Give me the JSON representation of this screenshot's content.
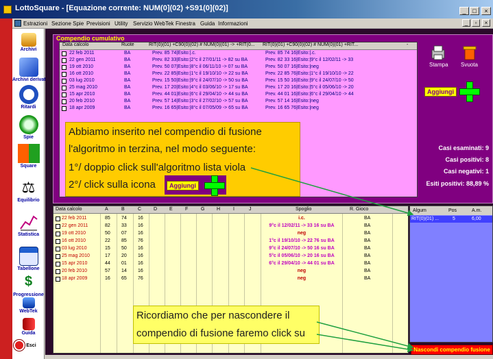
{
  "window": {
    "title": "LottoSquare - [Equazione corrente: NUM(0](02) +S91(0](02)]"
  },
  "menu": [
    "Estrazioni",
    "Sezione Spie",
    "Previsioni",
    "Utility",
    "Servizio WebTek",
    "Finestra",
    "Guida",
    "Informazioni"
  ],
  "toolbar": {
    "items": [
      {
        "label": "Archivi",
        "icon": "archive-icon"
      },
      {
        "label": "Archivi derivati",
        "icon": "derived-archive-icon"
      },
      {
        "label": "Ritardi",
        "icon": "clock-icon"
      },
      {
        "label": "Spie",
        "icon": "spyglass-icon"
      },
      {
        "label": "Square",
        "icon": "squares-icon"
      },
      {
        "label": "Equilibrio",
        "icon": "scales-icon"
      },
      {
        "label": "Statistica",
        "icon": "chart-icon"
      },
      {
        "label": "Tabellone",
        "icon": "calendar-icon"
      },
      {
        "label": "Progressione",
        "icon": "dollar-icon"
      },
      {
        "label": "WebTek",
        "icon": "webtek-icon"
      },
      {
        "label": "Guida",
        "icon": "book-icon"
      },
      {
        "label": "Esci",
        "icon": "exit-icon"
      }
    ]
  },
  "compendio": {
    "title": "Compendio cumulativo",
    "headers": [
      "Data calcolo",
      "Ruote",
      "RIT(0)(01) +C90(0)(02) # NUM(0)(01) -> +RIT(0...",
      "RIT(0)(01) +C90(0)(02) # NUM(0)(01) +RIT...",
      "-"
    ],
    "rows": [
      {
        "date": "22 feb 2011",
        "ruota": "BA",
        "c1": "Prev. 85 74|Esito:|.c.",
        "c2": "Prev. 85 74 16|Esito:|.c."
      },
      {
        "date": "22 gen 2011",
        "ruota": "BA",
        "c1": "Prev. 82 33|Esito:|2°c il 27/01/11 -> 82 su BA",
        "c2": "Prev. 82 33 16|Esito:|9°c il 12/02/11 -> 33"
      },
      {
        "date": "19 ott 2010",
        "ruota": "BA",
        "c1": "Prev. 50 07|Esito:|8°c il 06/11/10 -> 07 su BA",
        "c2": "Prev. 50 07 16|Esito:|neg"
      },
      {
        "date": "16 ott 2010",
        "ruota": "BA",
        "c1": "Prev. 22 85|Esito:|1°c il 19/10/10 -> 22 su BA",
        "c2": "Prev. 22 85 76|Esito:|1°c il 19/10/10 -> 22"
      },
      {
        "date": "03 lug 2010",
        "ruota": "BA",
        "c1": "Prev. 15 50|Esito:|9°c il 24/07/10 -> 50 su BA",
        "c2": "Prev. 15 50 16|Esito:|9°c il 24/07/10 -> 50"
      },
      {
        "date": "25 mag 2010",
        "ruota": "BA",
        "c1": "Prev. 17 20|Esito:|4°c il 03/06/10 -> 17 su BA",
        "c2": "Prev. 17 20 16|Esito:|5°c il 05/06/10 -> 20"
      },
      {
        "date": "15 apr 2010",
        "ruota": "BA",
        "c1": "Prev. 44 01|Esito:|6°c il 29/04/10 -> 44 su BA",
        "c2": "Prev. 44 01 16|Esito:|6°c il 29/04/10 -> 44"
      },
      {
        "date": "20 feb 2010",
        "ruota": "BA",
        "c1": "Prev. 57 14|Esito:|3°c il 27/02/10 -> 57 su BA",
        "c2": "Prev. 57 14 16|Esito:|neg"
      },
      {
        "date": "18 apr 2009",
        "ruota": "BA",
        "c1": "Prev. 16 65|Esito:|8°c il 07/05/09 -> 65 su BA",
        "c2": "Prev. 16 65 76|Esito:|neg"
      }
    ]
  },
  "actions": {
    "stampa": "Stampa",
    "svuota": "Svuota",
    "aggiungi": "Aggiungi"
  },
  "stats": {
    "casi_esaminati": "Casi esaminati: 9",
    "casi_positivi": "Casi positivi: 8",
    "casi_negativi": "Casi negativi: 1",
    "esiti_positivi": "Esiti positivi: 88,89 %"
  },
  "callout1": {
    "lines": [
      "Abbiamo inserito nel compendio di fusione",
      "l'algoritmo in terzina, nel modo seguente:",
      "1°/ doppio click sull'algoritmo lista viola",
      "2°/ click sulla icona"
    ]
  },
  "callout2": {
    "lines": [
      "Ricordiamo che per nascondere il",
      "compendio di fusione faremo click su"
    ]
  },
  "bottom": {
    "headers": [
      "Data calcolo",
      "A",
      "B",
      "C",
      "D",
      "E",
      "F",
      "G",
      "H",
      "I",
      "J",
      "Spoglio",
      "R. Gioco"
    ],
    "rows": [
      {
        "date": "22 feb 2011",
        "a": "85",
        "b": "74",
        "c": "16",
        "spoglio": "i.c.",
        "ruota": "BA"
      },
      {
        "date": "22 gen 2011",
        "a": "82",
        "b": "33",
        "c": "16",
        "spoglio": "9°c il 12/02/11 -> 33 16 su BA",
        "ruota": "BA"
      },
      {
        "date": "19 ott 2010",
        "a": "50",
        "b": "07",
        "c": "16",
        "spoglio": "neg",
        "ruota": "BA"
      },
      {
        "date": "16 ott 2010",
        "a": "22",
        "b": "85",
        "c": "76",
        "spoglio": "1°c il 19/10/10 -> 22 76 su BA",
        "ruota": "BA"
      },
      {
        "date": "03 lug 2010",
        "a": "15",
        "b": "50",
        "c": "16",
        "spoglio": "9°c il 24/07/10 -> 50 16 su BA",
        "ruota": "BA"
      },
      {
        "date": "25 mag 2010",
        "a": "17",
        "b": "20",
        "c": "16",
        "spoglio": "5°c il 05/06/10 -> 20 16 su BA",
        "ruota": "BA"
      },
      {
        "date": "15 apr 2010",
        "a": "44",
        "b": "01",
        "c": "16",
        "spoglio": "6°c il 29/04/10 -> 44 01 su BA",
        "ruota": "BA"
      },
      {
        "date": "20 feb 2010",
        "a": "57",
        "b": "14",
        "c": "16",
        "spoglio": "neg",
        "ruota": "BA"
      },
      {
        "date": "18 apr 2009",
        "a": "16",
        "b": "65",
        "c": "76",
        "spoglio": "neg",
        "ruota": "BA"
      }
    ]
  },
  "side": {
    "headers": [
      "Algum",
      "Pos",
      "A.m."
    ],
    "row": {
      "alg": "RIT(0)(01) ...",
      "pos": "5",
      "am": "6,00"
    }
  },
  "nascondi": "Nascondi compendio fusione",
  "colors": {
    "compendio_bg": "#800080",
    "list_pink": "#ff99ff",
    "bottom_yellow": "#ffffc8",
    "callout_orange": "#ffcc00",
    "callout_yellow": "#ffff66",
    "arrow_green": "#20a040"
  }
}
